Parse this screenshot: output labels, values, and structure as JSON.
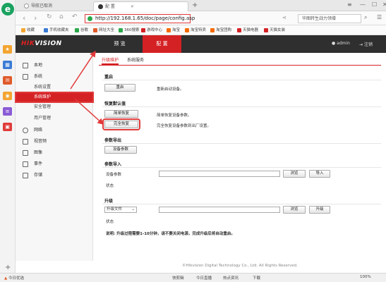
{
  "browser": {
    "tabs": [
      {
        "label": "导航已取消"
      },
      {
        "label": "配 置"
      }
    ],
    "new_tab": "+",
    "url": "http://192.168.1.65/doc/page/config.asp",
    "search_placeholder": "华图转生战力领增",
    "bookmarks": [
      {
        "label": "收藏",
        "color": "#f3a531"
      },
      {
        "label": "手机收藏夹",
        "color": "#3a7bd5"
      },
      {
        "label": "谷歌",
        "color": "#2aa84a"
      },
      {
        "label": "网址大全",
        "color": "#e05a2a"
      },
      {
        "label": "360搜索",
        "color": "#2aa84a"
      },
      {
        "label": "游戏中心",
        "color": "#d42124"
      },
      {
        "label": "淘宝",
        "color": "#f56a00"
      },
      {
        "label": "淘宝特卖",
        "color": "#f56a00"
      },
      {
        "label": "淘宝团购",
        "color": "#f56a00"
      },
      {
        "label": "天猫电器",
        "color": "#d42124"
      },
      {
        "label": "天猫女装",
        "color": "#d42124"
      }
    ]
  },
  "app": {
    "logo_a": "HIK",
    "logo_b": "VISION",
    "nav": [
      {
        "label": "预 览"
      },
      {
        "label": "配 置"
      }
    ],
    "user": "admin",
    "logout": "注销"
  },
  "sidebar": {
    "items": [
      {
        "label": "本地"
      },
      {
        "label": "系统"
      },
      {
        "label": "系统设置"
      },
      {
        "label": "系统维护"
      },
      {
        "label": "安全管理"
      },
      {
        "label": "用户管理"
      },
      {
        "label": "网络"
      },
      {
        "label": "视音频"
      },
      {
        "label": "图像"
      },
      {
        "label": "事件"
      },
      {
        "label": "存储"
      }
    ]
  },
  "subtabs": [
    {
      "label": "升级维护"
    },
    {
      "label": "系统服务"
    }
  ],
  "sections": {
    "reboot": {
      "title": "重启",
      "button": "重启",
      "desc": "重新启动设备。"
    },
    "restore": {
      "title": "恢复默认值",
      "simple_button": "简单恢复",
      "simple_desc": "简单恢复设备参数。",
      "full_button": "完全恢复",
      "full_desc": "完全恢复设备参数到出厂设置。"
    },
    "export": {
      "title": "参数导出",
      "button": "设备参数"
    },
    "import": {
      "title": "参数导入",
      "field_label": "设备参数",
      "browse": "浏览",
      "action": "导入",
      "status": "状态"
    },
    "upgrade": {
      "title": "升级",
      "select_value": "升级文件",
      "browse": "浏览",
      "action": "升级",
      "status": "状态"
    },
    "note": "说明: 升级过程需要1-10分钟，请不要关闭电源，完成升级后将自动重启。"
  },
  "footer": "©Hikvision Digital Technology Co., Ltd. All Rights Reserved.",
  "statusbar": {
    "left": "今日优选",
    "items": [
      "快剪辑",
      "今日直播",
      "热点资讯",
      "下载",
      "100%"
    ]
  }
}
